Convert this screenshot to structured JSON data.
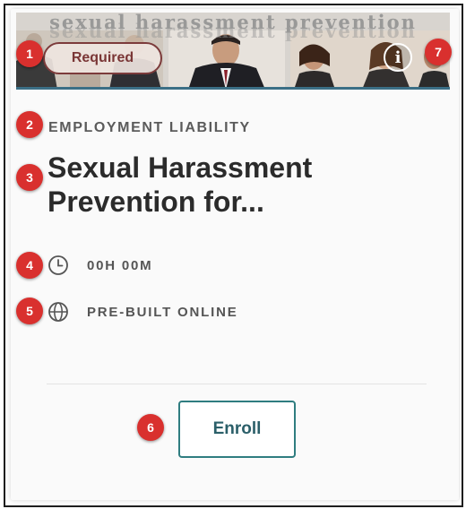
{
  "banner": {
    "image_text": "sexual harassment prevention",
    "required_label": "Required",
    "info_label": "i"
  },
  "course": {
    "category": "EMPLOYMENT LIABILITY",
    "title": "Sexual Harassment Prevention for...",
    "duration": "00H 00M",
    "delivery": "PRE-BUILT ONLINE"
  },
  "actions": {
    "enroll_label": "Enroll"
  },
  "callouts": [
    "1",
    "2",
    "3",
    "4",
    "5",
    "6",
    "7"
  ],
  "colors": {
    "callout": "#d9302e",
    "required_border": "#7c3b3b",
    "enroll_border": "#2f7d80",
    "banner_underline": "#3b6f86"
  },
  "icons": {
    "duration": "clock-icon",
    "delivery": "globe-icon",
    "info": "info-icon"
  }
}
